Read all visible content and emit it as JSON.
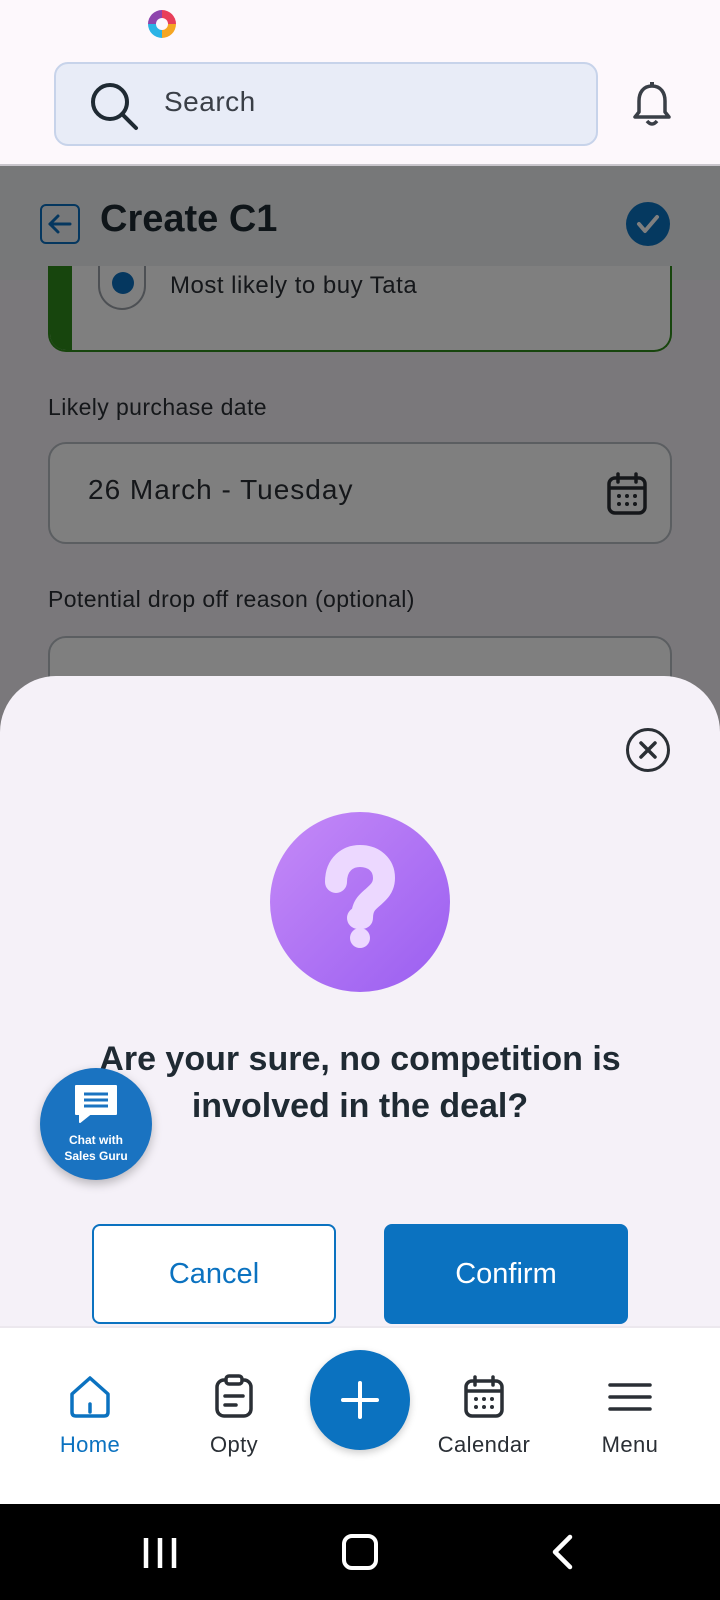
{
  "top_bar": {
    "search_placeholder": "Search"
  },
  "page": {
    "title": "Create C1",
    "radio_option_label": "Most likely to buy Tata",
    "purchase_date_label": "Likely purchase date",
    "purchase_date_value": "26 March - Tuesday",
    "dropoff_label": "Potential drop off reason (optional)"
  },
  "dialog": {
    "title": "Are your sure, no competition is involved in the deal?",
    "cancel_label": "Cancel",
    "confirm_label": "Confirm"
  },
  "chat_fab": {
    "line1": "Chat with",
    "line2": "Sales Guru"
  },
  "bottom_nav": {
    "items": [
      {
        "label": "Home",
        "icon": "home-icon",
        "active": true
      },
      {
        "label": "Opty",
        "icon": "clipboard-icon",
        "active": false
      },
      {
        "label": "Calendar",
        "icon": "calendar-icon",
        "active": false
      },
      {
        "label": "Menu",
        "icon": "menu-icon",
        "active": false
      }
    ]
  },
  "colors": {
    "primary": "#0b72c0",
    "accent_green": "#2e8a1a",
    "question_purple": "#a66cf3"
  }
}
